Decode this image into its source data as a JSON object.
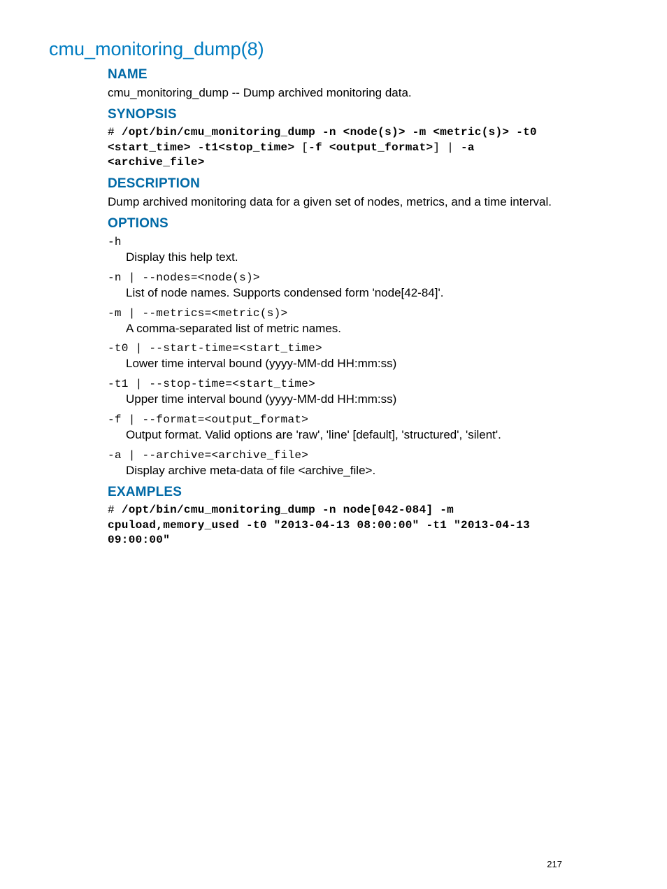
{
  "title": "cmu_monitoring_dump(8)",
  "sections": {
    "name": {
      "heading": "NAME",
      "body": "cmu_monitoring_dump -- Dump archived monitoring data."
    },
    "synopsis": {
      "heading": "SYNOPSIS",
      "prefix": "# ",
      "line1": "/opt/bin/cmu_monitoring_dump -n <node(s)> -m <metric(s)> -t0 <start_time> -t1<stop_time>",
      "mid1": " [",
      "bold2": "-f <output_format>",
      "mid2": "] | ",
      "bold3": "-a <archive_file>"
    },
    "description": {
      "heading": "DESCRIPTION",
      "body": "Dump archived monitoring data for a given set of nodes, metrics, and a time interval."
    },
    "options": {
      "heading": "OPTIONS",
      "items": [
        {
          "flag": "-h",
          "desc": "Display this help text."
        },
        {
          "flag": "-n | --nodes=<node(s)>",
          "desc": "List of node names. Supports condensed form 'node[42-84]'."
        },
        {
          "flag": "-m | --metrics=<metric(s)>",
          "desc": "A comma-separated list of metric names."
        },
        {
          "flag": "-t0 | --start-time=<start_time>",
          "desc": "Lower time interval bound (yyyy-MM-dd HH:mm:ss)"
        },
        {
          "flag": "-t1 | --stop-time=<start_time>",
          "desc": "Upper time interval bound (yyyy-MM-dd HH:mm:ss)"
        },
        {
          "flag": "-f | --format=<output_format>",
          "desc": "Output format. Valid options are 'raw', 'line' [default], 'structured', 'silent'."
        },
        {
          "flag": "-a | --archive=<archive_file>",
          "desc": "Display archive meta-data of file <archive_file>."
        }
      ]
    },
    "examples": {
      "heading": "EXAMPLES",
      "prefix": "# ",
      "cmd": "/opt/bin/cmu_monitoring_dump -n node[042-084] -m cpuload,memory_used -t0 \"2013-04-13 08:00:00\" -t1 \"2013-04-13 09:00:00\""
    }
  },
  "page_number": "217"
}
